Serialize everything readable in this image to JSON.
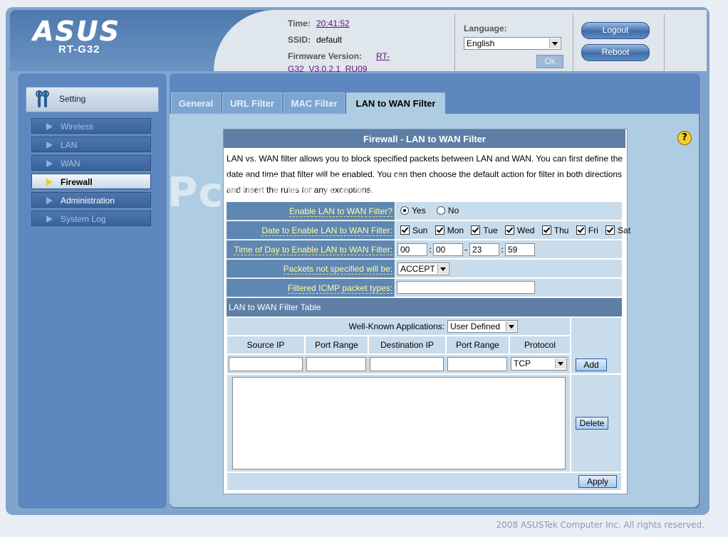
{
  "header": {
    "brand": "ASUS",
    "model": "RT-G32",
    "time_label": "Time:",
    "time_value": "20:41:52",
    "ssid_label": "SSID:",
    "ssid_value": "default",
    "firmware_label": "Firmware Version:",
    "firmware_value_line1": "RT-",
    "firmware_value_line2": "G32_V3.0.2.1_RU09",
    "language_label": "Language:",
    "language_value": "English",
    "ok_label": "Ok",
    "logout_label": "Logout",
    "reboot_label": "Reboot"
  },
  "sidebar": {
    "title": "Setting",
    "items": [
      {
        "label": "Wireless",
        "active": false
      },
      {
        "label": "LAN",
        "active": false
      },
      {
        "label": "WAN",
        "active": false
      },
      {
        "label": "Firewall",
        "active": true
      },
      {
        "label": "Administration",
        "active": false
      },
      {
        "label": "System Log",
        "active": false
      }
    ]
  },
  "tabs": [
    "General",
    "URL Filter",
    "MAC Filter",
    "LAN to WAN Filter"
  ],
  "help_icon": "?",
  "panel": {
    "title": "Firewall - LAN to WAN Filter",
    "description": "LAN vs. WAN filter allows you to block specified packets between LAN and WAN. You can first define the date and time that filter will be enabled. You can then choose the default action for filter in both directions and insert the rules for any exceptions.",
    "enable_label": "Enable LAN to WAN Filter?",
    "enable_yes": "Yes",
    "enable_no": "No",
    "date_label": "Date to Enable LAN to WAN Filter:",
    "days": [
      "Sun",
      "Mon",
      "Tue",
      "Wed",
      "Thu",
      "Fri",
      "Sat"
    ],
    "time_label": "Time of Day to Enable LAN to WAN Filter:",
    "time_start_h": "00",
    "time_start_m": "00",
    "time_end_h": "23",
    "time_end_m": "59",
    "time_sep_colon": ":",
    "time_sep_dash": "-",
    "packets_label": "Packets not specified will be:",
    "packets_value": "ACCEPT",
    "icmp_label": "Filtered ICMP packet types:",
    "icmp_value": ""
  },
  "table": {
    "title": "LAN to WAN Filter Table",
    "well_known_label": "Well-Known Applications:",
    "well_known_value": "User Defined",
    "columns": [
      "Source IP",
      "Port Range",
      "Destination IP",
      "Port Range",
      "Protocol"
    ],
    "protocol_value": "TCP",
    "add_label": "Add",
    "delete_label": "Delete",
    "apply_label": "Apply"
  },
  "watermark": "PcWinTech.com",
  "footer": "2008 ASUSTek Computer Inc. All rights reserved.",
  "colors": {
    "accent": "#5c88bf",
    "label_text": "#fffe9c",
    "link": "#6a0d83"
  }
}
